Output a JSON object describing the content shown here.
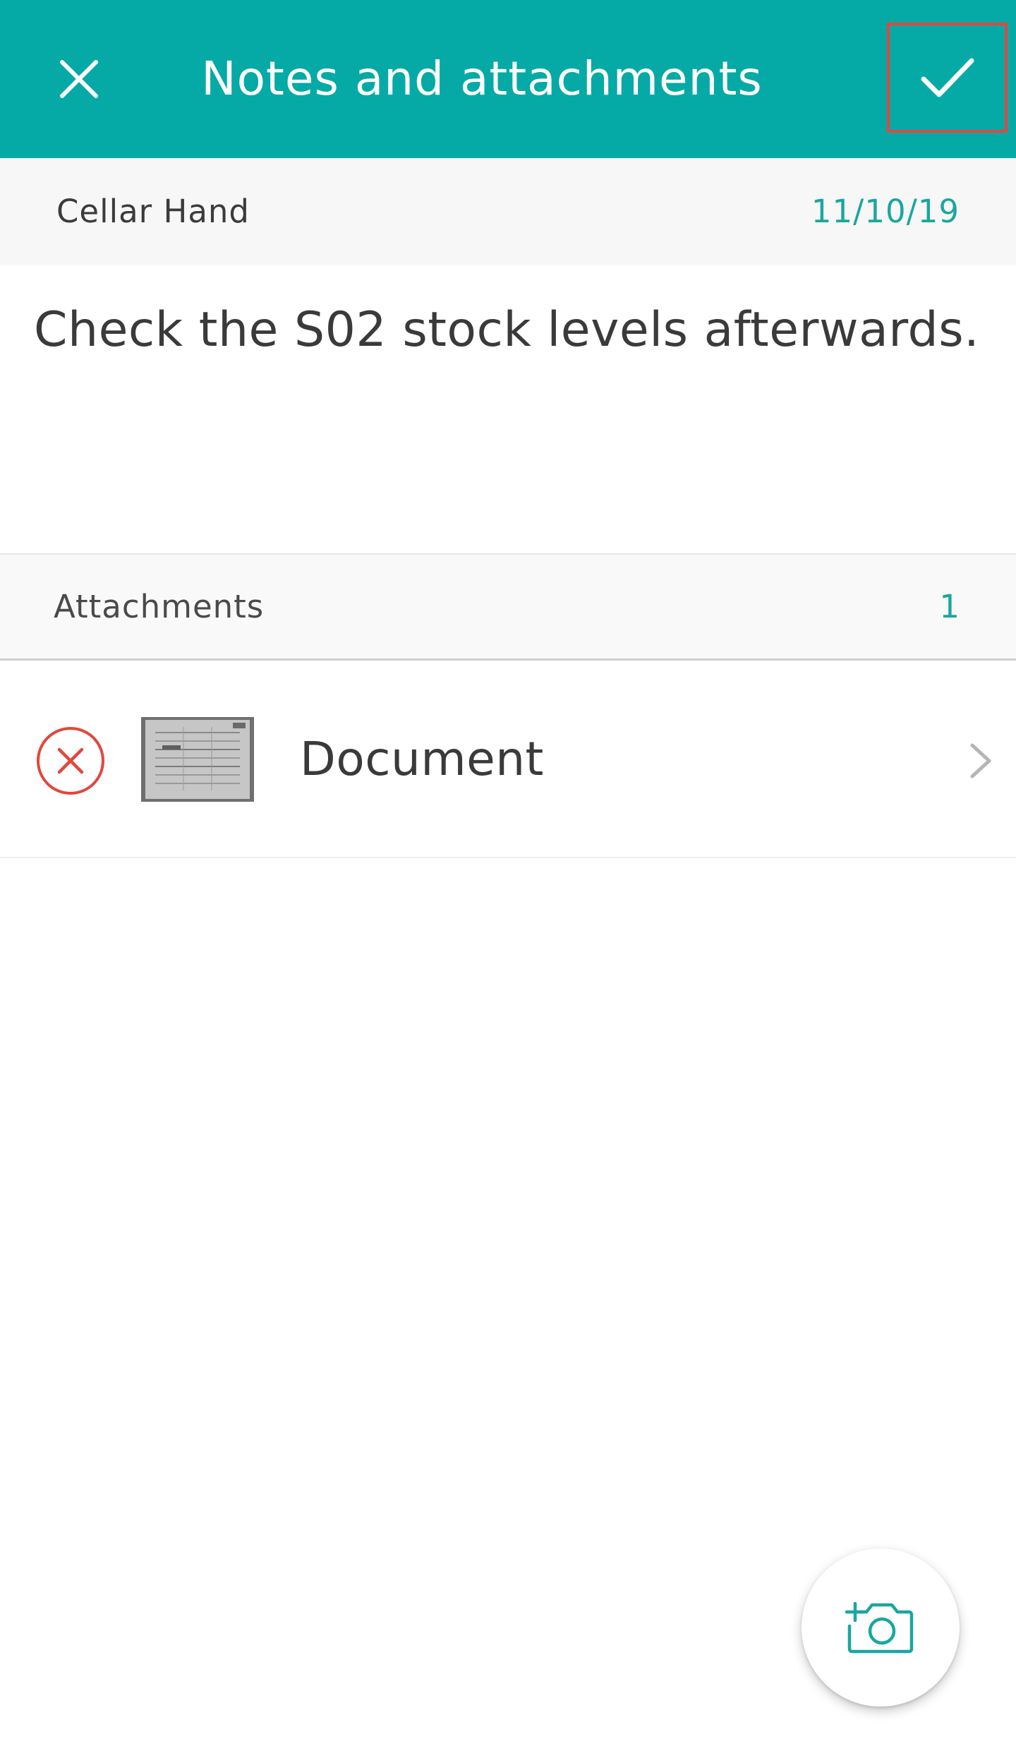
{
  "app_bar": {
    "title": "Notes and attachments",
    "close_icon": "close-icon",
    "confirm_icon": "check-icon",
    "background_color": "#05aaa6",
    "highlight_color": "#e0483d"
  },
  "note": {
    "author": "Cellar Hand",
    "date": "11/10/19",
    "text": "Check the S02 stock levels afterwards."
  },
  "attachments": {
    "header_label": "Attachments",
    "count": "1",
    "items": [
      {
        "name": "Document",
        "remove_icon": "remove-circle-icon",
        "thumbnail": "document-scan-thumbnail",
        "chevron_icon": "chevron-right-icon"
      }
    ]
  },
  "fab": {
    "icon": "add-photo-icon",
    "accent_color": "#1aa6a0"
  }
}
